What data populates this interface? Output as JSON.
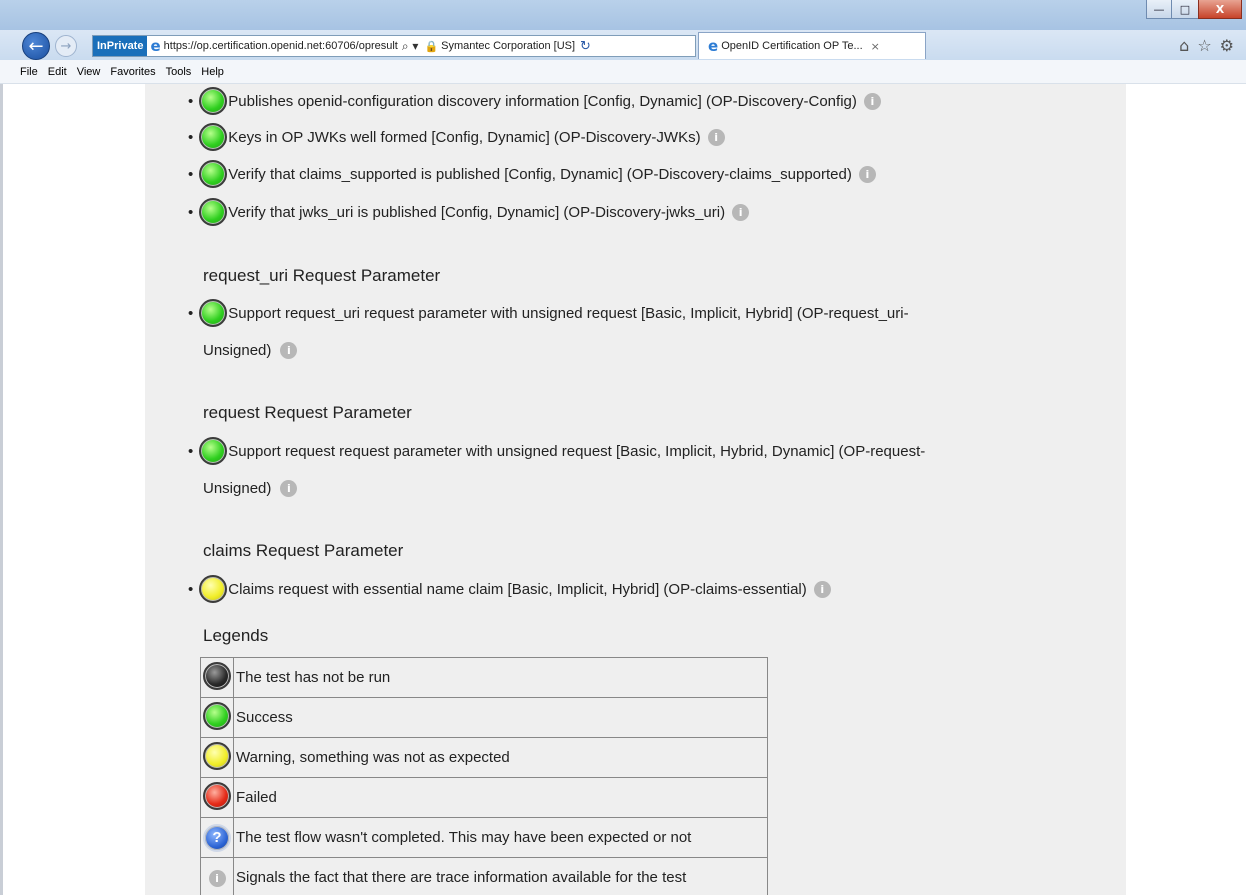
{
  "window": {
    "controls": {
      "minimize": "—",
      "maximize": "□",
      "close": "X"
    }
  },
  "browser": {
    "inprivate_label": "InPrivate",
    "url": "https://op.certification.openid.net:60706/opresult",
    "certificate": "Symantec Corporation [US]",
    "tab_title": "OpenID Certification OP Te...",
    "tab_close": "×"
  },
  "menu": {
    "items": [
      {
        "acc": "F",
        "rest": "ile"
      },
      {
        "acc": "E",
        "rest": "dit"
      },
      {
        "acc": "V",
        "rest": "iew"
      },
      {
        "acc": "F",
        "rest": "avorites",
        "split": "Fa"
      },
      {
        "acc": "T",
        "rest": "ools"
      },
      {
        "acc": "H",
        "rest": "elp"
      }
    ],
    "labels": [
      "File",
      "Edit",
      "View",
      "Favorites",
      "Tools",
      "Help"
    ]
  },
  "tests": {
    "discovery_config": {
      "status": "green",
      "text": "Publishes openid-configuration discovery information [Config, Dynamic] (OP-Discovery-Config)"
    },
    "discovery_jwks": {
      "status": "green",
      "text": "Keys in OP JWKs well formed [Config, Dynamic] (OP-Discovery-JWKs)"
    },
    "discovery_claims": {
      "status": "green",
      "text": "Verify that claims_supported is published [Config, Dynamic] (OP-Discovery-claims_supported)"
    },
    "discovery_jwks_uri": {
      "status": "green",
      "text": "Verify that jwks_uri is published [Config, Dynamic] (OP-Discovery-jwks_uri)"
    },
    "request_uri_unsigned": {
      "status": "green",
      "text_line1": "Support request_uri request parameter with unsigned request [Basic, Implicit, Hybrid] (OP-request_uri-",
      "text_line2": "Unsigned)"
    },
    "request_unsigned": {
      "status": "green",
      "text_line1": "Support request request parameter with unsigned request [Basic, Implicit, Hybrid, Dynamic] (OP-request-",
      "text_line2": "Unsigned)"
    },
    "claims_essential": {
      "status": "yellow",
      "text": "Claims request with essential name claim [Basic, Implicit, Hybrid] (OP-claims-essential)"
    }
  },
  "sections": {
    "request_uri": "request_uri Request Parameter",
    "request": "request Request Parameter",
    "claims": "claims Request Parameter",
    "legends": "Legends"
  },
  "legend": [
    {
      "icon": "black-light-icon",
      "text": "The test has not be run"
    },
    {
      "icon": "green-light-icon",
      "text": "Success"
    },
    {
      "icon": "yellow-light-icon",
      "text": "Warning, something was not as expected"
    },
    {
      "icon": "red-light-icon",
      "text": "Failed"
    },
    {
      "icon": "question-icon",
      "text": "The test flow wasn't completed. This may have been expected or not"
    },
    {
      "icon": "info-icon",
      "text": "Signals the fact that there are trace information available for the test"
    }
  ],
  "glyphs": {
    "bullet": "•",
    "info": "i",
    "question": "?"
  },
  "colors": {
    "inprivate": "#1a6fba",
    "page_bg": "#efefef",
    "success": "#2fcf1f",
    "warning": "#f1ee2a"
  }
}
